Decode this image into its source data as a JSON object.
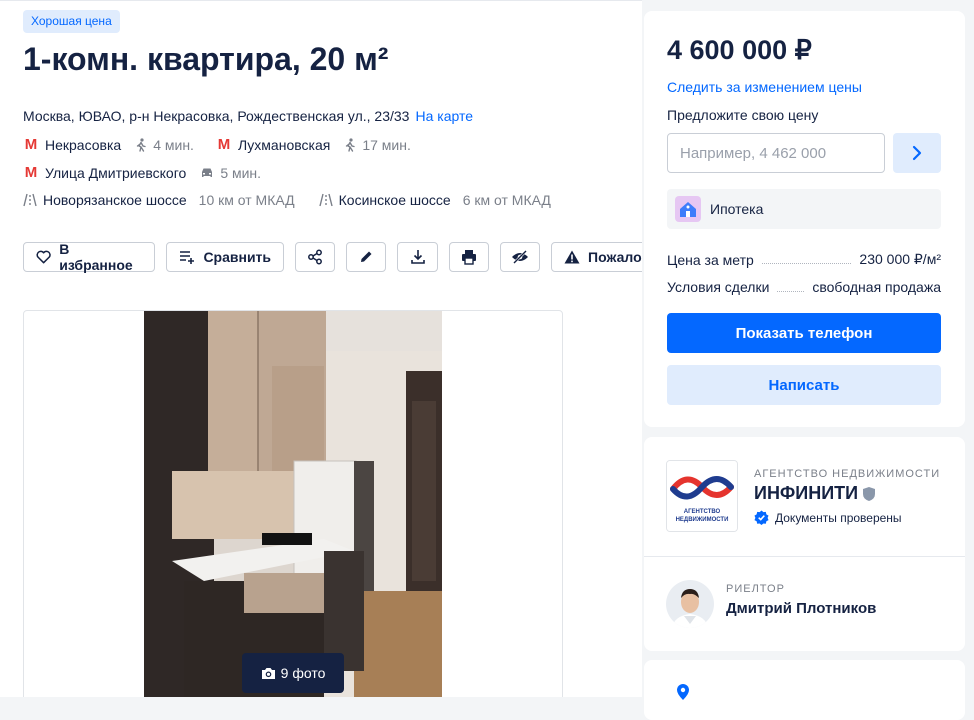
{
  "listing": {
    "badge": "Хорошая цена",
    "title": "1-комн. квартира, 20 м²",
    "address": "Москва, ЮВАО, р-н Некрасовка, Рождественская ул., 23/33",
    "map_link": "На карте",
    "metro": [
      {
        "name": "Некрасовка",
        "time": "4 мин.",
        "mode": "walk-icon"
      },
      {
        "name": "Лухмановская",
        "time": "17 мин.",
        "mode": "walk-icon"
      },
      {
        "name": "Улица Дмитриевского",
        "time": "5 мин.",
        "mode": "car-icon"
      }
    ],
    "highways": [
      {
        "name": "Новорязанское шоссе",
        "distance": "10 км от МКАД"
      },
      {
        "name": "Косинское шоссе",
        "distance": "6 км от МКАД"
      }
    ]
  },
  "actions": {
    "favorite": "В избранное",
    "compare": "Сравнить",
    "report": "Пожаловаться"
  },
  "gallery": {
    "photo_count": "9 фото"
  },
  "price_card": {
    "price": "4 600 000 ₽",
    "watch_link": "Следить за изменением цены",
    "offer_label": "Предложите свою цену",
    "offer_placeholder": "Например, 4 462 000",
    "mortgage": "Ипотека",
    "price_per_meter_label": "Цена за метр",
    "price_per_meter_value": "230 000 ₽/м²",
    "deal_terms_label": "Условия сделки",
    "deal_terms_value": "свободная продажа",
    "phone_button": "Показать телефон",
    "write_button": "Написать"
  },
  "agency": {
    "type": "АГЕНТСТВО НЕДВИЖИМОСТИ",
    "name": "ИНФИНИТИ",
    "verified": "Документы проверены",
    "logo_caption": "АГЕНТСТВО НЕДВИЖИМОСТИ"
  },
  "realtor": {
    "role": "РИЕЛТОР",
    "name": "Дмитрий Плотников"
  },
  "colors": {
    "accent": "#0468ff",
    "metro": "#e53935",
    "text": "#152242",
    "muted": "#7a7f89"
  }
}
